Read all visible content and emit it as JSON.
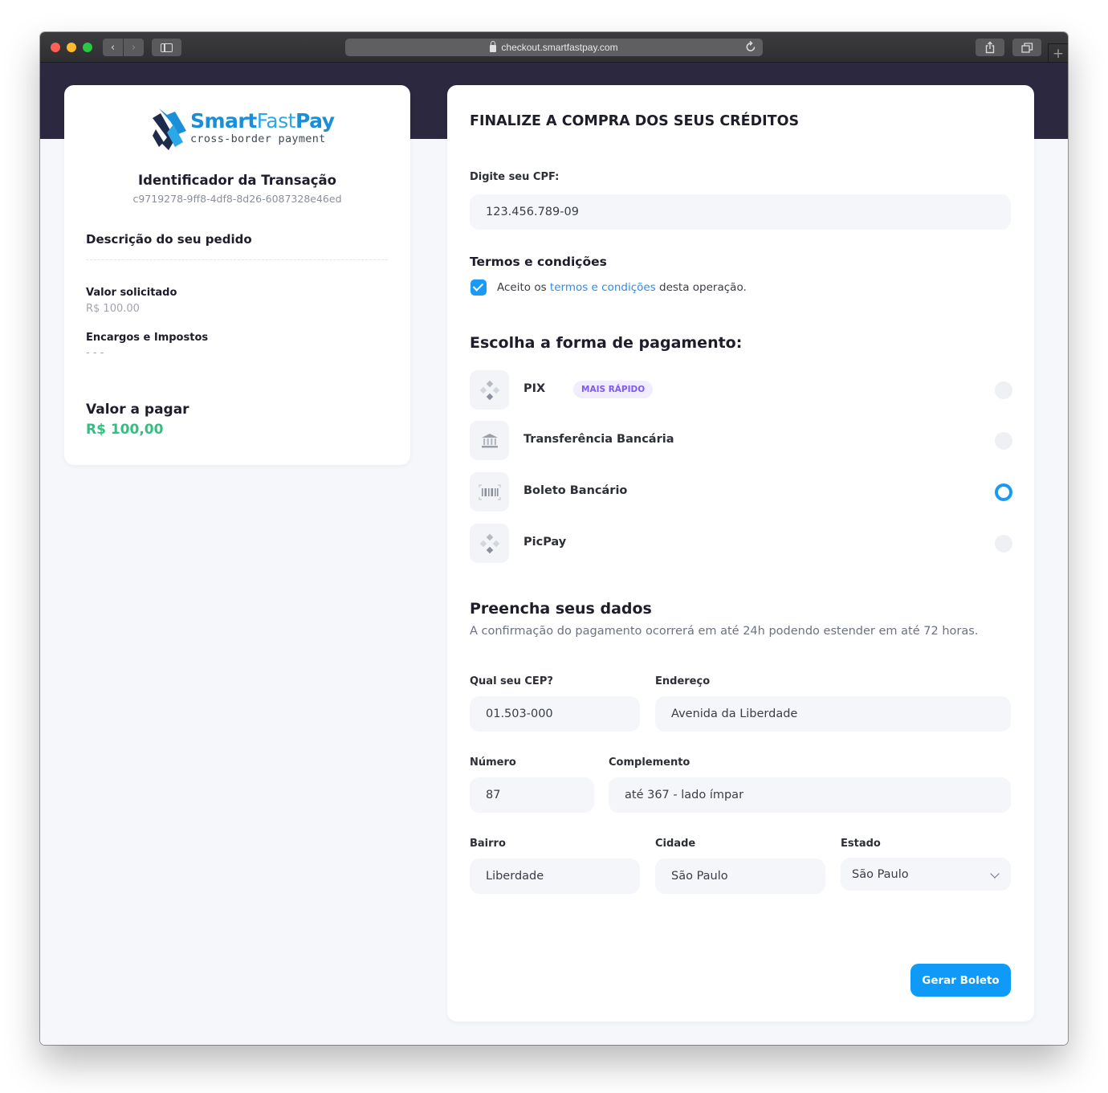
{
  "browser": {
    "url": "checkout.smartfastpay.com",
    "back_glyph": "‹",
    "forward_glyph": "›",
    "newtab_glyph": "+"
  },
  "brand": {
    "name_part1": "Smart",
    "name_part2": "Fast",
    "name_part3": "Pay",
    "tagline": "cross-border payment",
    "colors": {
      "primary": "#1a8fd8",
      "dark": "#1f2b4a"
    }
  },
  "summary": {
    "transaction_title": "Identificador da Transação",
    "transaction_id": "c9719278-9ff8-4df8-8d26-6087328e46ed",
    "order_description": "Descrição do seu pedido",
    "requested_label": "Valor solicitado",
    "requested_value": "R$ 100.00",
    "fees_label": "Encargos e Impostos",
    "fees_value": "- - -",
    "pay_label": "Valor a pagar",
    "pay_amount": "R$ 100,00"
  },
  "checkout": {
    "title": "FINALIZE A COMPRA DOS SEUS CRÉDITOS",
    "cpf_label": "Digite seu CPF:",
    "cpf_value": "123.456.789-09",
    "terms_title": "Termos e condições",
    "terms_checked": true,
    "terms_prefix": "Aceito os ",
    "terms_link": "termos e condições",
    "terms_suffix": " desta operação.",
    "payment_title": "Escolha a forma de pagamento:",
    "payment_methods": [
      {
        "label": "PIX",
        "badge": "MAIS RÁPIDO",
        "icon": "pix-icon",
        "selected": false
      },
      {
        "label": "Transferência Bancária",
        "icon": "bank-icon",
        "selected": false
      },
      {
        "label": "Boleto Bancário",
        "icon": "barcode-icon",
        "selected": true
      },
      {
        "label": "PicPay",
        "icon": "picpay-icon",
        "selected": false
      }
    ],
    "data_title": "Preencha seus dados",
    "data_subtitle": "A confirmação do pagamento ocorrerá em até 24h podendo estender em até 72 horas.",
    "fields": {
      "cep": {
        "label": "Qual seu CEP?",
        "value": "01.503-000"
      },
      "address": {
        "label": "Endereço",
        "value": "Avenida da Liberdade"
      },
      "number": {
        "label": "Número",
        "value": "87"
      },
      "complement": {
        "label": "Complemento",
        "value": "até 367 - lado ímpar"
      },
      "district": {
        "label": "Bairro",
        "value": "Liberdade"
      },
      "city": {
        "label": "Cidade",
        "value": "São Paulo"
      },
      "state": {
        "label": "Estado",
        "value": "São Paulo"
      }
    },
    "submit_label": "Gerar Boleto",
    "accent_color": "#0f9af7",
    "success_color": "#2ec27e"
  }
}
